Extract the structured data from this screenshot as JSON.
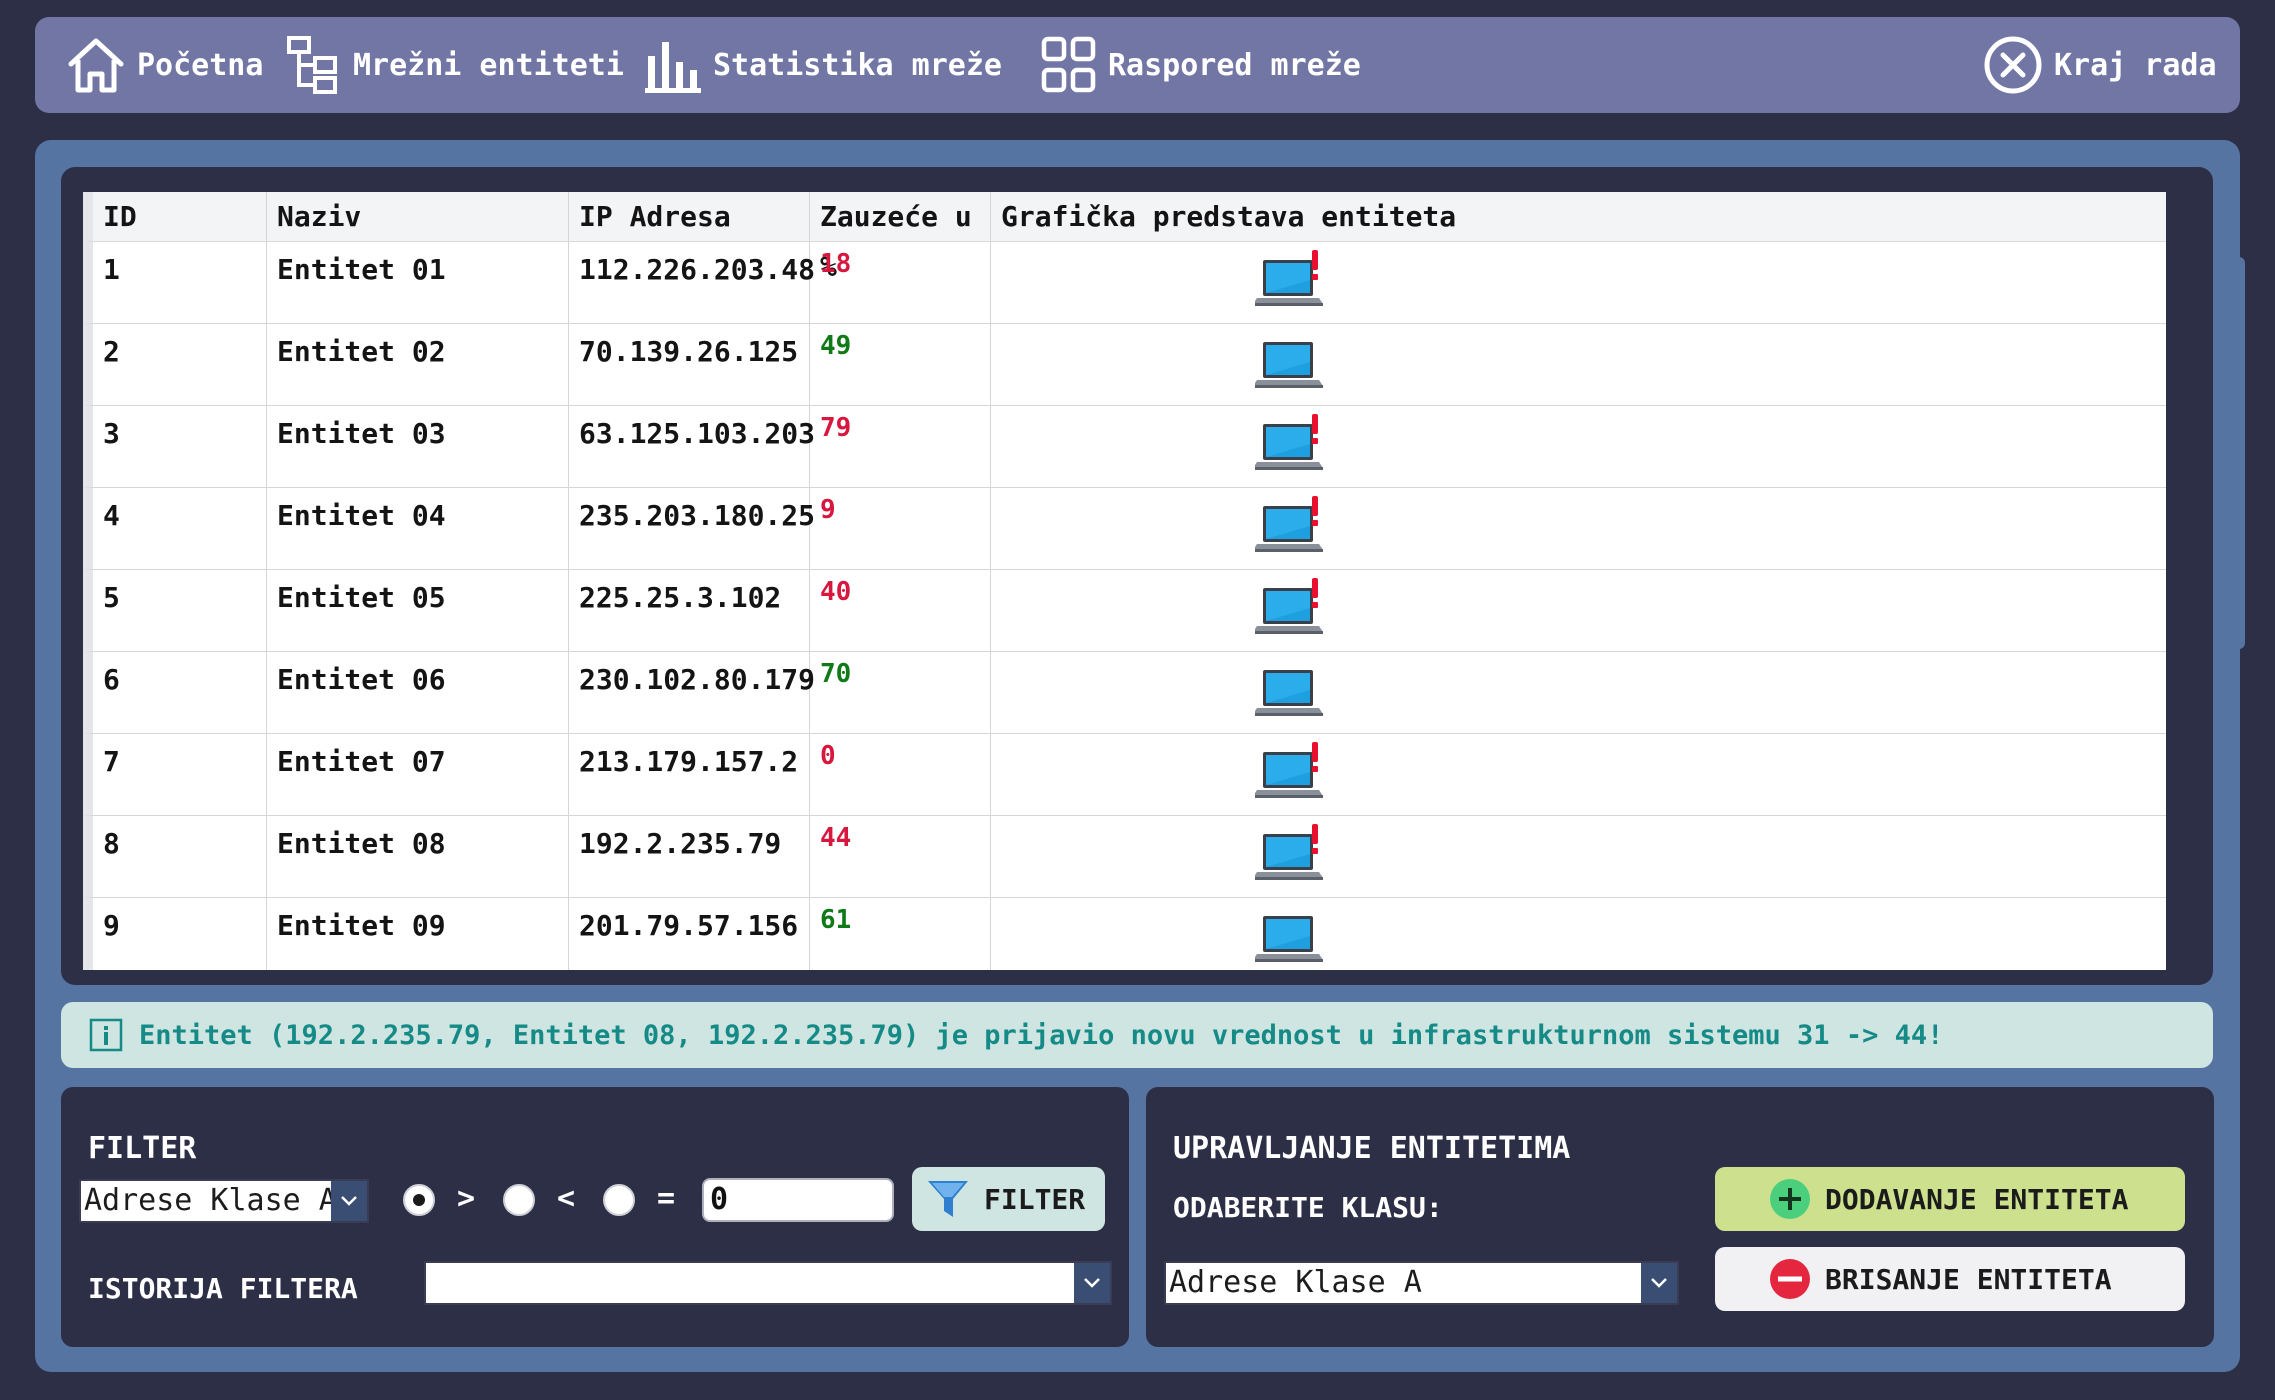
{
  "nav": {
    "home": "Početna",
    "entities": "Mrežni entiteti",
    "stats": "Statistika mreže",
    "layout": "Raspored mreže",
    "exit": "Kraj rada"
  },
  "table": {
    "headers": [
      "ID",
      "Naziv",
      "IP Adresa",
      "Zauzeće u %",
      "Grafička predstava entiteta"
    ],
    "rows": [
      {
        "id": "1",
        "name": "Entitet 01",
        "ip": "112.226.203.48",
        "value": "18",
        "status": "alert"
      },
      {
        "id": "2",
        "name": "Entitet 02",
        "ip": "70.139.26.125",
        "value": "49",
        "status": "ok"
      },
      {
        "id": "3",
        "name": "Entitet 03",
        "ip": "63.125.103.203",
        "value": "79",
        "status": "alert"
      },
      {
        "id": "4",
        "name": "Entitet 04",
        "ip": "235.203.180.25",
        "value": "9",
        "status": "alert"
      },
      {
        "id": "5",
        "name": "Entitet 05",
        "ip": "225.25.3.102",
        "value": "40",
        "status": "alert"
      },
      {
        "id": "6",
        "name": "Entitet 06",
        "ip": "230.102.80.179",
        "value": "70",
        "status": "ok"
      },
      {
        "id": "7",
        "name": "Entitet 07",
        "ip": "213.179.157.2",
        "value": "0",
        "status": "alert"
      },
      {
        "id": "8",
        "name": "Entitet 08",
        "ip": "192.2.235.79",
        "value": "44",
        "status": "alert"
      },
      {
        "id": "9",
        "name": "Entitet 09",
        "ip": "201.79.57.156",
        "value": "61",
        "status": "ok"
      }
    ]
  },
  "notification": "Entitet (192.2.235.79, Entitet 08, 192.2.235.79) je prijavio novu vrednost u infrastrukturnom sistemu 31 -> 44!",
  "filter": {
    "title": "FILTER",
    "class_value": "Adrese Klase A",
    "op_gt": ">",
    "op_lt": "<",
    "op_eq": "=",
    "value": "0",
    "button": "FILTER",
    "history_label": "ISTORIJA FILTERA",
    "history_value": ""
  },
  "manage": {
    "title": "UPRAVLJANJE ENTITETIMA",
    "class_label": "ODABERITE KLASU:",
    "class_value": "Adrese Klase A",
    "add_button": "DODAVANJE ENTITETA",
    "delete_button": "BRISANJE ENTITETA"
  },
  "colors": {
    "alert_value": "#d8173f",
    "ok_value": "#0f7a17",
    "nav_bg": "#7276a5",
    "panel_bg": "#5674a1"
  },
  "icons": {
    "home": "home-icon",
    "entities": "tree-icon",
    "stats": "bar-chart-icon",
    "layout": "grid-icon",
    "exit": "close-circle-icon",
    "info": "info-icon",
    "filter": "funnel-icon",
    "add": "plus-circle-icon",
    "delete": "minus-circle-icon",
    "entity": "laptop-icon"
  }
}
